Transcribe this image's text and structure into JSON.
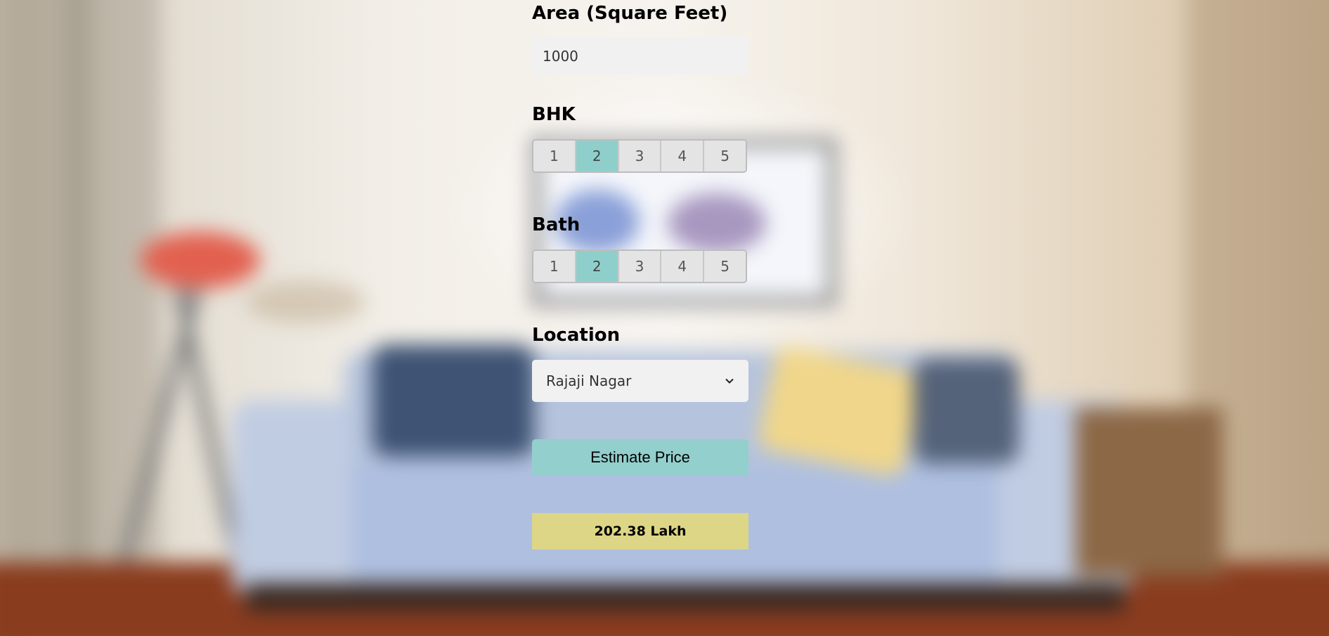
{
  "form": {
    "area": {
      "label": "Area (Square Feet)",
      "value": "1000"
    },
    "bhk": {
      "label": "BHK",
      "options": [
        "1",
        "2",
        "3",
        "4",
        "5"
      ],
      "selected": "2"
    },
    "bath": {
      "label": "Bath",
      "options": [
        "1",
        "2",
        "3",
        "4",
        "5"
      ],
      "selected": "2"
    },
    "location": {
      "label": "Location",
      "selected": "Rajaji Nagar"
    },
    "estimate_button": "Estimate Price",
    "result": "202.38 Lakh"
  },
  "colors": {
    "selected_option": "#8fcfcb",
    "button": "#93cfcc",
    "result_background": "#ddd686"
  }
}
